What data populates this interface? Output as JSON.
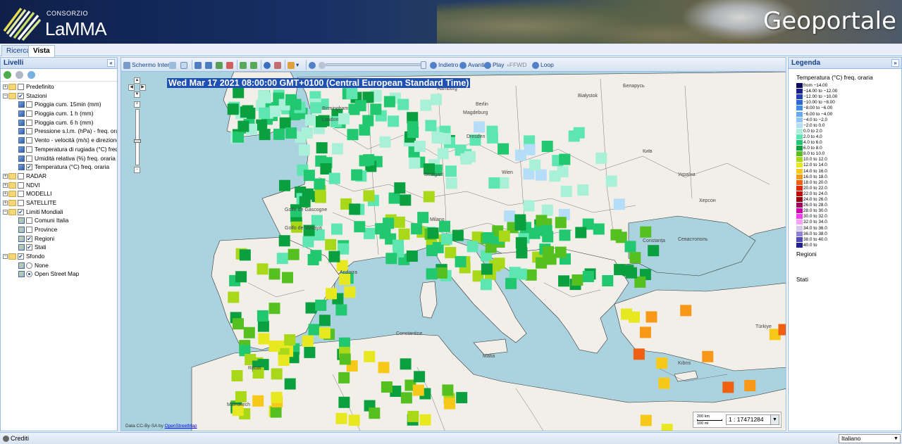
{
  "header": {
    "logo_consorzio": "CONSORZIO",
    "logo_lamma": "LaMMA",
    "portal_title": "Geoportale"
  },
  "tabs": [
    {
      "label": "Ricerca",
      "active": false
    },
    {
      "label": "Vista",
      "active": true
    }
  ],
  "layers_panel": {
    "title": "Livelli",
    "tree": [
      {
        "label": "Predefinito",
        "depth": 0,
        "kind": "folder",
        "expanded": false,
        "checked": false
      },
      {
        "label": "Stazioni",
        "depth": 0,
        "kind": "folder",
        "expanded": true,
        "checked": true
      },
      {
        "label": "Pioggia cum. 15min (mm)",
        "depth": 1,
        "kind": "layer",
        "checked": false
      },
      {
        "label": "Pioggia cum. 1 h (mm)",
        "depth": 1,
        "kind": "layer",
        "checked": false
      },
      {
        "label": "Pioggia cum. 6 h (mm)",
        "depth": 1,
        "kind": "layer",
        "checked": false
      },
      {
        "label": "Pressione s.l.m. (hPa) - freq. oraria",
        "depth": 1,
        "kind": "layer",
        "checked": false
      },
      {
        "label": "Vento - velocità (m/s) e direzione (°) fr",
        "depth": 1,
        "kind": "layer",
        "checked": false
      },
      {
        "label": "Temperatura di rugiada (°C) freq. orari",
        "depth": 1,
        "kind": "layer",
        "checked": false
      },
      {
        "label": "Umidità relativa (%) freq. oraria",
        "depth": 1,
        "kind": "layer",
        "checked": false
      },
      {
        "label": "Temperatura (°C) freq. oraria",
        "depth": 1,
        "kind": "layer",
        "checked": true
      },
      {
        "label": "RADAR",
        "depth": 0,
        "kind": "folder",
        "expanded": false,
        "checked": false
      },
      {
        "label": "NDVI",
        "depth": 0,
        "kind": "folder",
        "expanded": false,
        "checked": false
      },
      {
        "label": "MODELLI",
        "depth": 0,
        "kind": "folder",
        "expanded": false,
        "checked": false
      },
      {
        "label": "SATELLITE",
        "depth": 0,
        "kind": "folder",
        "expanded": false,
        "checked": false
      },
      {
        "label": "Limiti Mondiali",
        "depth": 0,
        "kind": "folder",
        "expanded": true,
        "checked": true
      },
      {
        "label": "Comuni Italia",
        "depth": 1,
        "kind": "maplayer",
        "checked": false
      },
      {
        "label": "Province",
        "depth": 1,
        "kind": "maplayer",
        "checked": false
      },
      {
        "label": "Regioni",
        "depth": 1,
        "kind": "maplayer",
        "checked": true
      },
      {
        "label": "Stati",
        "depth": 1,
        "kind": "maplayer",
        "checked": true
      },
      {
        "label": "Sfondo",
        "depth": 0,
        "kind": "folder",
        "expanded": true,
        "checked": true
      },
      {
        "label": "None",
        "depth": 1,
        "kind": "radio",
        "checked": false
      },
      {
        "label": "Open Street Map",
        "depth": 1,
        "kind": "radio",
        "checked": true
      }
    ]
  },
  "map_toolbar": {
    "full_extent": "Schermo Intero",
    "back": "Indietro",
    "forward": "Avanti",
    "play": "Play",
    "ffwd": "FFWD",
    "loop": "Loop"
  },
  "map": {
    "timestamp": "Wed Mar 17 2021 08:00:00 GMT+0100 (Central European Standard Time)",
    "attribution_prefix": "Data CC-By-SA by ",
    "attribution_link": "OpenStreetMap",
    "scale_top": "200 km",
    "scale_bottom": "100 mi",
    "scale_value": "1 : 17471284",
    "places": [
      {
        "name": "Hamburg"
      },
      {
        "name": "Berlin"
      },
      {
        "name": "Białystok"
      },
      {
        "name": "Беларусь"
      },
      {
        "name": "London"
      },
      {
        "name": "Birmingham"
      },
      {
        "name": "Magdeburg"
      },
      {
        "name": "Dresden"
      },
      {
        "name": "Stuttgart"
      },
      {
        "name": "Wien"
      },
      {
        "name": "Київ"
      },
      {
        "name": "Україна"
      },
      {
        "name": "Milano"
      },
      {
        "name": "Golfe de Gascogne"
      },
      {
        "name": "Golfo de Vizcaya"
      },
      {
        "name": "Andorra"
      },
      {
        "name": "Constanța"
      },
      {
        "name": "Севастополь"
      },
      {
        "name": "Херсон"
      },
      {
        "name": "Constantine"
      },
      {
        "name": "Malta"
      },
      {
        "name": "Rabat"
      },
      {
        "name": "Marrakech"
      },
      {
        "name": "Kıbrıs"
      },
      {
        "name": "Türkiye"
      }
    ]
  },
  "legend_panel": {
    "title": "Legenda",
    "layer_title": "Temperatura (°C) freq. oraria",
    "classes": [
      {
        "label": "from −14.00",
        "color": "#0a0a66"
      },
      {
        "label": "−14.00 to −12.00",
        "color": "#1a1f8c"
      },
      {
        "label": "−12.00 to −10.00",
        "color": "#2340b8"
      },
      {
        "label": "−10.00 to −8.00",
        "color": "#2c68d8"
      },
      {
        "label": "−8.00 to −6.00",
        "color": "#3f8ce8"
      },
      {
        "label": "−6.00 to −4.00",
        "color": "#63aaf0"
      },
      {
        "label": "−4.0 to −2.0",
        "color": "#8ec6f5"
      },
      {
        "label": "−2.0 to 0.0",
        "color": "#b6ddf8"
      },
      {
        "label": "0.0 to 2.0",
        "color": "#a8f0d8"
      },
      {
        "label": "2.0 to 4.0",
        "color": "#5ee6b0"
      },
      {
        "label": "4.0 to 6.0",
        "color": "#22c870"
      },
      {
        "label": "6.0 to 8.0",
        "color": "#0aa040"
      },
      {
        "label": "8.0 to 10.0",
        "color": "#55c020"
      },
      {
        "label": "10.0 to 12.0",
        "color": "#a8d818"
      },
      {
        "label": "12.0 to 14.0",
        "color": "#e8e820"
      },
      {
        "label": "14.0 to 16.0",
        "color": "#f8c818"
      },
      {
        "label": "16.0 to 18.0",
        "color": "#f89818"
      },
      {
        "label": "18.0 to 20.0",
        "color": "#f06010"
      },
      {
        "label": "20.0 to 22.0",
        "color": "#e02808"
      },
      {
        "label": "22.0 to 24.0",
        "color": "#c00808"
      },
      {
        "label": "24.0 to 26.0",
        "color": "#980010"
      },
      {
        "label": "26.0 to 28.0",
        "color": "#a00060"
      },
      {
        "label": "28.0 to 30.0",
        "color": "#d000b0"
      },
      {
        "label": "30.0 to 32.0",
        "color": "#f040f0"
      },
      {
        "label": "32.0 to 34.0",
        "color": "#f8a0f8"
      },
      {
        "label": "34.0 to 36.0",
        "color": "#d8c8f0"
      },
      {
        "label": "36.0 to 38.0",
        "color": "#9080d8"
      },
      {
        "label": "38.0 to 40.0",
        "color": "#5048b8"
      },
      {
        "label": "40.0 to",
        "color": "#202090"
      }
    ],
    "extra_layers": [
      "Regioni",
      "Stati"
    ]
  },
  "footer": {
    "credits": "Crediti",
    "language": "Italiano"
  },
  "colors": {
    "sea": "#aad3df",
    "land": "#f2efe9",
    "panel_border": "#99bbe8",
    "timestamp_bg": "#1f50b3"
  }
}
